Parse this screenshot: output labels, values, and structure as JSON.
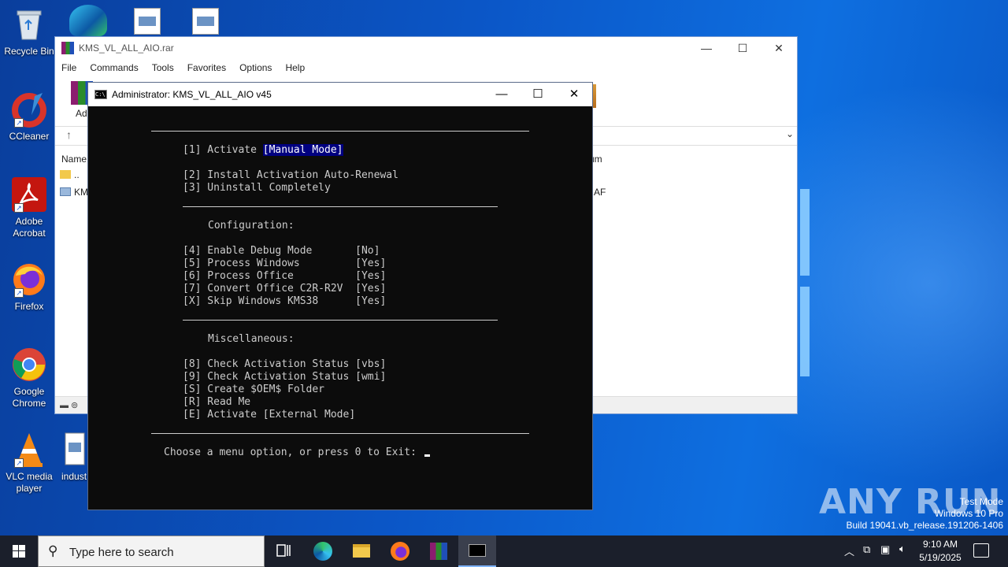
{
  "desktop": {
    "icons": [
      {
        "label": "Recycle Bin"
      },
      {
        "label": "CCleaner"
      },
      {
        "label": "Adobe Acrobat"
      },
      {
        "label": "Firefox"
      },
      {
        "label": "Google Chrome"
      },
      {
        "label": "VLC media player"
      },
      {
        "label": "indust"
      }
    ]
  },
  "winrar": {
    "title": "KMS_VL_ALL_AIO.rar",
    "menu": [
      "File",
      "Commands",
      "Tools",
      "Favorites",
      "Options",
      "Help"
    ],
    "toolbar_first_label": "Ad",
    "column_name": "Name",
    "column_checksum": "um",
    "rows": [
      {
        "name": ".."
      },
      {
        "name": "KM",
        "checksum": "AF"
      }
    ]
  },
  "console": {
    "title": "Administrator:  KMS_VL_ALL_AIO v45",
    "lines": {
      "l1_prefix": "[1] Activate ",
      "l1_highlight": "[Manual Mode]",
      "l2": "[2] Install Activation Auto-Renewal",
      "l3": "[3] Uninstall Completely",
      "config_header": "Configuration:",
      "l4": "[4] Enable Debug Mode       [No]",
      "l5": "[5] Process Windows         [Yes]",
      "l6": "[6] Process Office          [Yes]",
      "l7": "[7] Convert Office C2R-R2V  [Yes]",
      "lx": "[X] Skip Windows KMS38      [Yes]",
      "misc_header": "Miscellaneous:",
      "l8": "[8] Check Activation Status [vbs]",
      "l9": "[9] Check Activation Status [wmi]",
      "ls": "[S] Create $OEM$ Folder",
      "lr": "[R] Read Me",
      "le": "[E] Activate [External Mode]",
      "prompt": "Choose a menu option, or press 0 to Exit: "
    }
  },
  "taskbar": {
    "search_placeholder": "Type here to search",
    "time": "9:10 AM",
    "date": "5/19/2025"
  },
  "watermark": {
    "line1": "Test Mode",
    "line2": "Windows 10 Pro",
    "line3": "Build 19041.vb_release.191206-1406",
    "brand": "ANY RUN"
  }
}
